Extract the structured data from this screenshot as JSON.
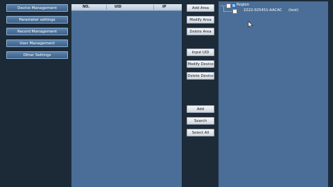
{
  "sidebar": {
    "items": [
      {
        "label": "Device Management"
      },
      {
        "label": "Parameter settings"
      },
      {
        "label": "Record Management"
      },
      {
        "label": "User Management"
      },
      {
        "label": "Other Settings"
      }
    ]
  },
  "device_table": {
    "columns": [
      "NO.",
      "UID",
      "IP"
    ]
  },
  "actions": {
    "add_area": "Add Area",
    "modify_area": "Modify Area",
    "delete_area": "Delete Area",
    "input_uid": "Input UID",
    "modify_device": "Modify Device",
    "delete_device": "Delete Device",
    "add": "Add",
    "search": "Search",
    "select_all": "Select All"
  },
  "tree": {
    "root_label": "Region",
    "child_label": "2222-025451-AACAC",
    "child_status": "(test)"
  },
  "colors": {
    "panel_bg": "#4a6e97",
    "app_bg": "#1d2a38",
    "sidebar_button": "#4a72a0"
  }
}
